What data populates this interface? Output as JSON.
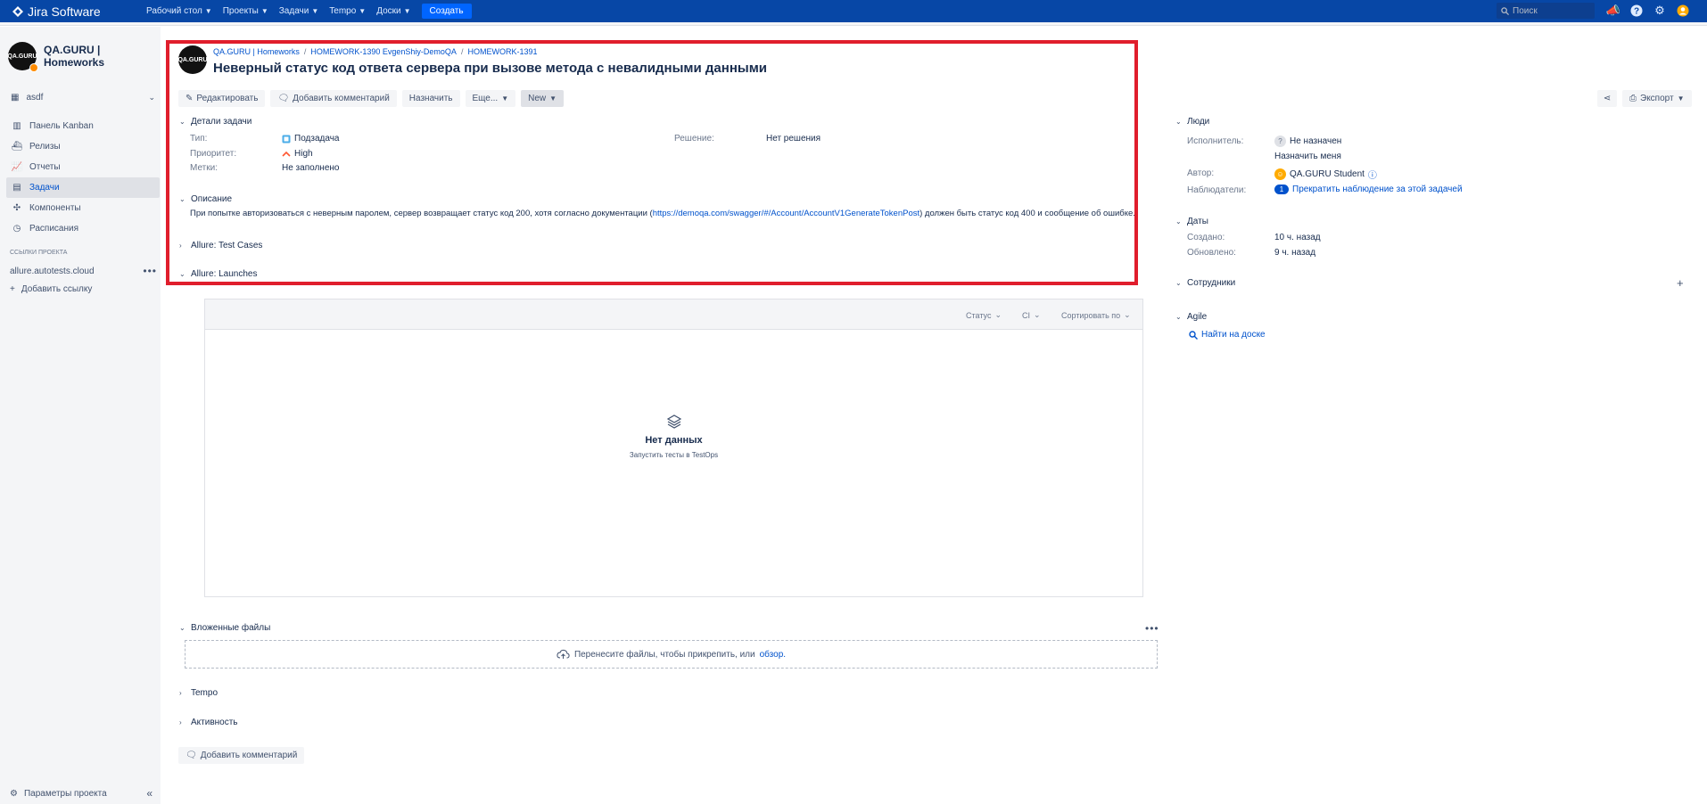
{
  "topnav": {
    "brand": "Jira Software",
    "menu": [
      "Рабочий стол",
      "Проекты",
      "Задачи",
      "Tempo",
      "Доски"
    ],
    "create": "Создать",
    "search_placeholder": "Поиск"
  },
  "sidebar": {
    "project_name": "QA.GURU | Homeworks",
    "avatar_text": "QA.GURU",
    "board": "asdf",
    "items": [
      "Панель Kanban",
      "Релизы",
      "Отчеты",
      "Задачи",
      "Компоненты",
      "Расписания"
    ],
    "links_title": "ССЫЛКИ ПРОЕКТА",
    "link": "allure.autotests.cloud",
    "add_link": "Добавить ссылку",
    "settings": "Параметры проекта"
  },
  "issue": {
    "breadcrumb": [
      "QA.GURU | Homeworks",
      "HOMEWORK-1390 EvgenShiy-DemoQA",
      "HOMEWORK-1391"
    ],
    "title": "Неверный статус код ответа сервера при вызове метода с невалидными данными",
    "actions": {
      "edit": "Редактировать",
      "comment": "Добавить комментарий",
      "assign": "Назначить",
      "more": "Еще...",
      "status": "New",
      "export": "Экспорт"
    },
    "details": {
      "title": "Детали задачи",
      "type_label": "Тип:",
      "type_value": "Подзадача",
      "priority_label": "Приоритет:",
      "priority_value": "High",
      "labels_label": "Метки:",
      "labels_value": "Не заполнено",
      "resolution_label": "Решение:",
      "resolution_value": "Нет решения"
    },
    "description": {
      "title": "Описание",
      "text_before": "При попытке авторизоваться с неверным паролем, сервер возвращает статус код 200, хотя согласно документации (",
      "link": "https://demoqa.com/swagger/#/Account/AccountV1GenerateTokenPost",
      "text_after": ") должен быть статус код 400 и сообщение об ошибке."
    },
    "allure_test_cases": "Allure: Test Cases",
    "allure_launches": "Allure: Launches",
    "launches": {
      "filters": [
        "Статус",
        "CI",
        "Сортировать по"
      ],
      "empty_title": "Нет данных",
      "empty_sub": "Запустить тесты в TestOps"
    },
    "attachments": {
      "title": "Вложенные файлы",
      "drop_text": "Перенесите файлы, чтобы прикрепить, или",
      "browse": "обзор."
    },
    "tempo": "Tempo",
    "activity": "Активность",
    "add_comment": "Добавить комментарий"
  },
  "people": {
    "title": "Люди",
    "assignee_label": "Исполнитель:",
    "assignee": "Не назначен",
    "assign_me": "Назначить меня",
    "reporter_label": "Автор:",
    "reporter": "QA.GURU Student",
    "watchers_label": "Наблюдатели:",
    "watchers_count": "1",
    "watch_link": "Прекратить наблюдение за этой задачей"
  },
  "dates": {
    "title": "Даты",
    "created_label": "Создано:",
    "created": "10 ч. назад",
    "updated_label": "Обновлено:",
    "updated": "9 ч. назад"
  },
  "employees": {
    "title": "Сотрудники"
  },
  "agile": {
    "title": "Agile",
    "find": "Найти на доске"
  },
  "colors": {
    "topbar": "#0747a6",
    "highlight": "#e01e2c",
    "link": "#0052cc"
  }
}
